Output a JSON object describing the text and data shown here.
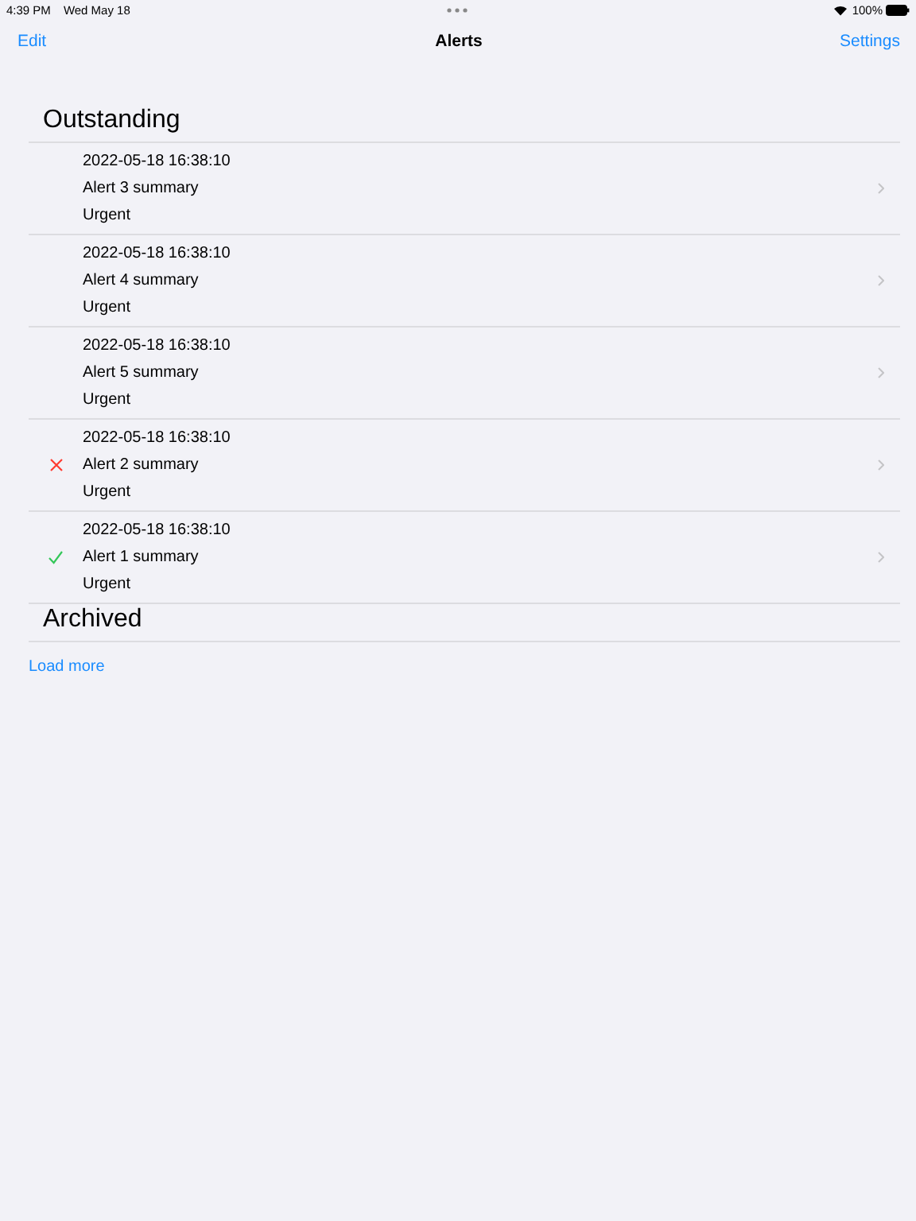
{
  "status_bar": {
    "time": "4:39 PM",
    "date": "Wed May 18",
    "battery": "100%"
  },
  "nav": {
    "left": "Edit",
    "title": "Alerts",
    "right": "Settings"
  },
  "sections": [
    {
      "title": "Outstanding",
      "alerts": [
        {
          "timestamp": "2022-05-18 16:38:10",
          "summary": "Alert 3 summary",
          "severity": "Urgent",
          "kind": "plain"
        },
        {
          "timestamp": "2022-05-18 16:38:10",
          "summary": "Alert 4 summary",
          "severity": "Urgent",
          "kind": "plain"
        },
        {
          "timestamp": "2022-05-18 16:38:10",
          "summary": "Alert 5 summary",
          "severity": "Urgent",
          "kind": "plain"
        },
        {
          "timestamp": "2022-05-18 16:38:10",
          "summary": "Alert 2 summary",
          "severity": "Urgent",
          "kind": "rejected"
        },
        {
          "timestamp": "2022-05-18 16:38:10",
          "summary": "Alert 1 summary",
          "severity": "Urgent",
          "kind": "acknowledged"
        }
      ]
    },
    {
      "title": "Archived"
    }
  ],
  "load_more": "Load more"
}
